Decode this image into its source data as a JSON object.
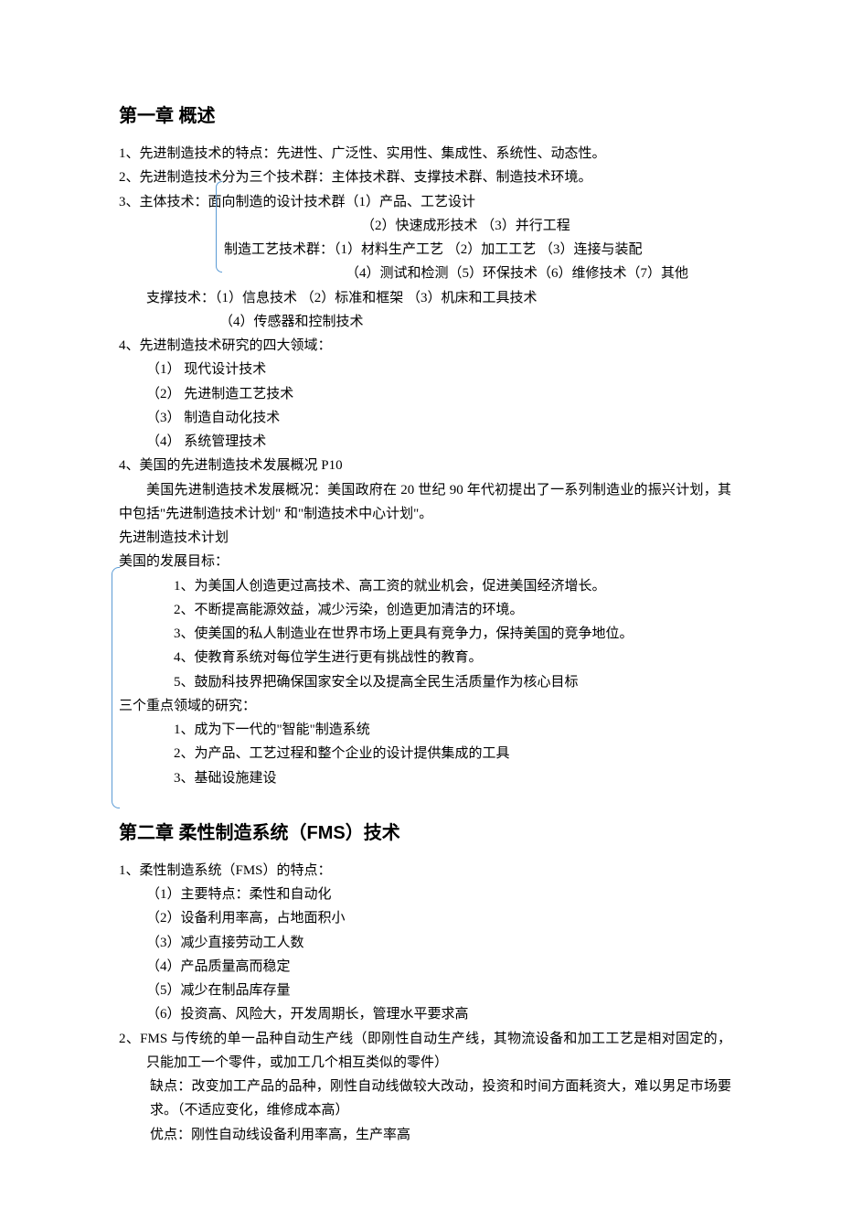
{
  "chapter1": {
    "title": "第一章 概述",
    "p1": "1、先进制造技术的特点：先进性、广泛性、实用性、集成性、系统性、动态性。",
    "p2": "2、先进制造技术分为三个技术群：主体技术群、支撑技术群、制造技术环境。",
    "p3_lead": "3、主体技术：",
    "p3_a": "面向制造的设计技术群（1）产品、工艺设计",
    "p3_b": "（2）快速成形技术   （3）并行工程",
    "p3_c": "制造工艺技术群：（1）材料生产工艺 （2）加工工艺 （3）连接与装配",
    "p3_d": "（4）测试和检测（5）环保技术（6）维修技术（7）其他",
    "p3_e": "支撑技术：（1）信息技术   （2）标准和框架   （3）机床和工具技术",
    "p3_f": "（4）传感器和控制技术",
    "p4_head": "4、先进制造技术研究的四大领域：",
    "p4_items": [
      "（1） 现代设计技术",
      "（2） 先进制造工艺技术",
      "（3） 制造自动化技术",
      "（4） 系统管理技术"
    ],
    "p5": "4、美国的先进制造技术发展概况   P10",
    "p5_body": "美国先进制造技术发展概况：美国政府在 20 世纪 90 年代初提出了一系列制造业的振兴计划，其中包括\"先进制造技术计划\" 和\"制造技术中心计划\"。",
    "p5_plan": "先进制造技术计划",
    "p5_goal_head": "美国的发展目标：",
    "p5_goals": [
      "1、为美国人创造更过高技术、高工资的就业机会，促进美国经济增长。",
      "2、不断提高能源效益，减少污染，创造更加清洁的环境。",
      "3、使美国的私人制造业在世界市场上更具有竞争力，保持美国的竞争地位。",
      "4、使教育系统对每位学生进行更有挑战性的教育。",
      "5、鼓励科技界把确保国家安全以及提高全民生活质量作为核心目标"
    ],
    "p5_field_head": "三个重点领域的研究：",
    "p5_fields": [
      "1、成为下一代的\"智能\"制造系统",
      "2、为产品、工艺过程和整个企业的设计提供集成的工具",
      "3、基础设施建设"
    ]
  },
  "chapter2": {
    "title": "第二章 柔性制造系统（FMS）技术",
    "p1_head": "1、柔性制造系统（FMS）的特点：",
    "p1_items": [
      "（1）主要特点：柔性和自动化",
      "（2）设备利用率高，占地面积小",
      "（3）减少直接劳动工人数",
      "（4）产品质量高而稳定",
      "（5）减少在制品库存量",
      "（6）投资高、风险大，开发周期长，管理水平要求高"
    ],
    "p2_a": "2、FMS 与传统的单一品种自动生产线（即刚性自动生产线，其物流设备和加工工艺是相对固定的，只能加工一个零件，或加工几个相互类似的零件）",
    "p2_b": "缺点：改变加工产品的品种，刚性自动线做较大改动，投资和时间方面耗资大，难以男足市场要求。（不适应变化，维修成本高）",
    "p2_c": "优点：刚性自动线设备利用率高，生产率高"
  }
}
